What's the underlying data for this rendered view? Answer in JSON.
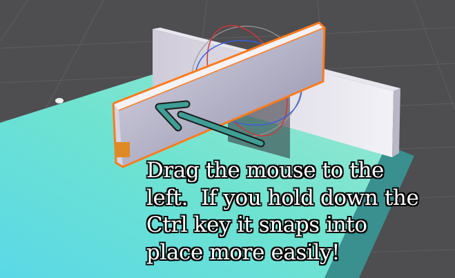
{
  "caption": {
    "lines": [
      "Drag the mouse to the",
      "left.  If you hold down the",
      "Ctrl key it snaps into",
      "place more easily!"
    ]
  },
  "colors": {
    "background": "#4e4d50",
    "grid": "#626164",
    "floor": "#6fe3d2",
    "wall": "#c9c6d4",
    "selection_outline": "#ff7a1a",
    "rotation_gizmo_fill": "#f5e55a",
    "arrow": "#3f9e96"
  },
  "icons": {
    "rotation_gizmo": "rotate-gizmo-icon",
    "direction_arrow": "arrow-left-icon"
  }
}
